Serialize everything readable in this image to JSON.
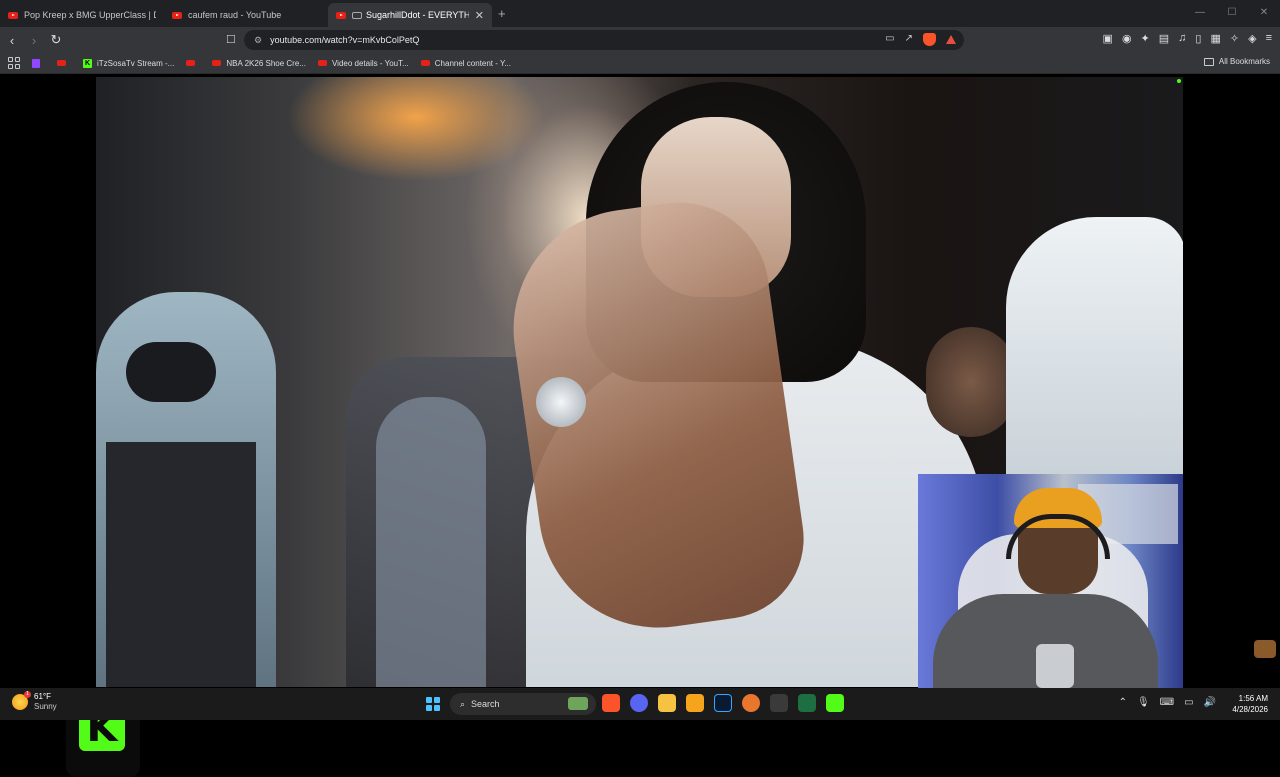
{
  "tabs": [
    {
      "title": "Pop Kreep x BMG UpperClass | Drill M",
      "active": false
    },
    {
      "title": "caufem raud - YouTube",
      "active": false
    },
    {
      "title": "SugarhillDdot - EVERYTHING",
      "active": true
    }
  ],
  "window_controls": {
    "minimize": "—",
    "maximize": "☐",
    "close": "✕"
  },
  "address": {
    "url": "youtube.com/watch?v=mKvbColPetQ"
  },
  "bookmarks": [
    {
      "label": "",
      "icon": "twitch-icon"
    },
    {
      "label": "",
      "icon": "youtube-icon"
    },
    {
      "label": "iTzSosaTv Stream -...",
      "icon": "kick-icon"
    },
    {
      "label": "",
      "icon": "youtube-icon"
    },
    {
      "label": "NBA 2K26 Shoe Cre...",
      "icon": "youtube-icon"
    },
    {
      "label": "Video details - YouT...",
      "icon": "youtube-icon"
    },
    {
      "label": "Channel content - Y...",
      "icon": "youtube-icon"
    }
  ],
  "all_bookmarks": "All Bookmarks",
  "overlay": {
    "kick_logo": "K"
  },
  "taskbar": {
    "weather_temp": "61°F",
    "weather_desc": "Sunny",
    "weather_badge": "1",
    "search_label": "Search",
    "time": "1:56 AM",
    "date": "4/28/2026"
  },
  "colors": {
    "kick_green": "#53fc18",
    "youtube_red": "#e62117",
    "brave_orange": "#fb542b"
  }
}
